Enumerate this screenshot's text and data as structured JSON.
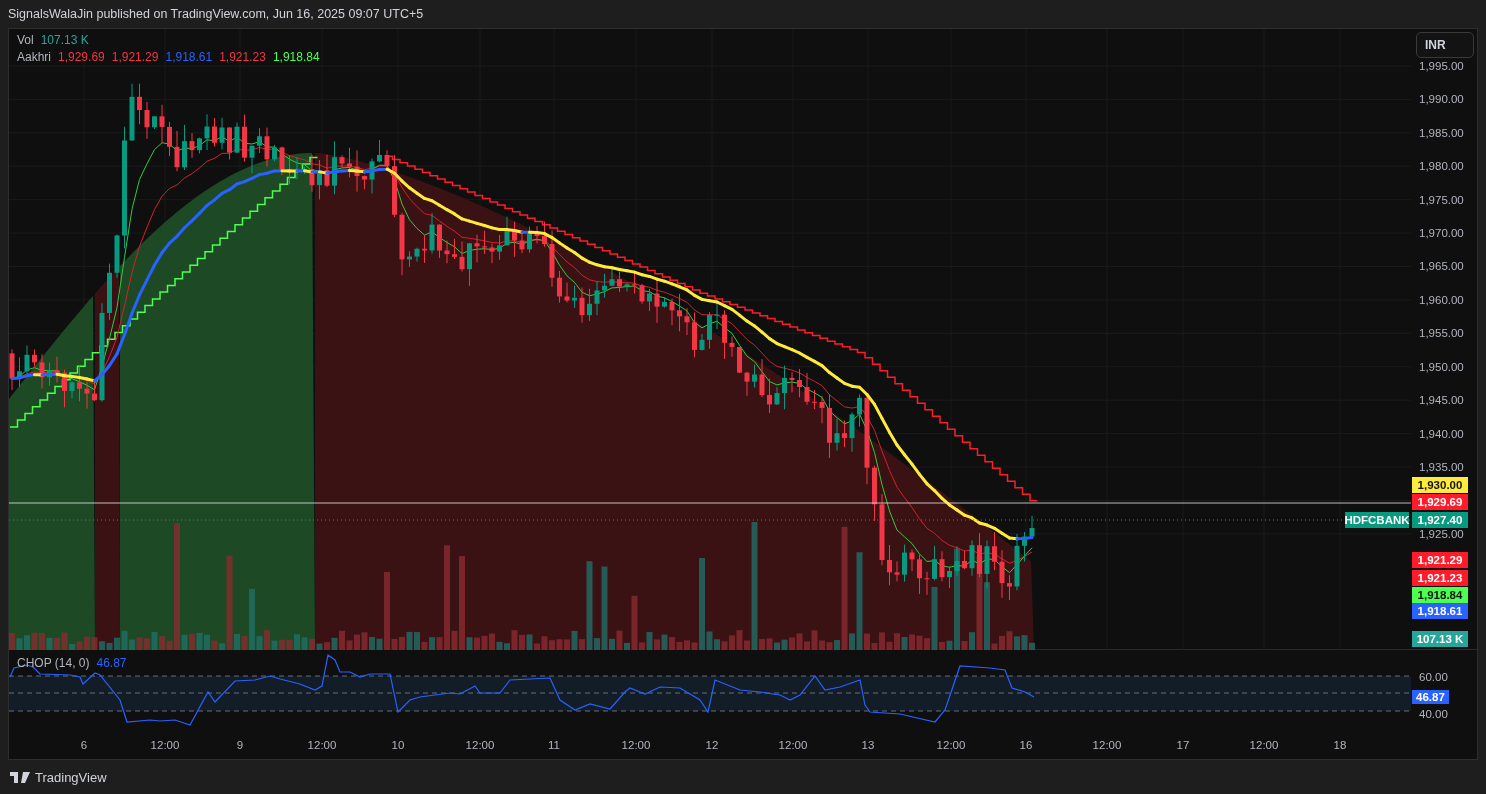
{
  "header": {
    "text": "SignalsWalaJin published on TradingView.com, Jun 16, 2025 09:07 UTC+5"
  },
  "legend": {
    "volume": {
      "label": "Vol",
      "value": "107.13 K"
    },
    "indicator": {
      "name": "Aakhri",
      "values": [
        {
          "text": "1,929.69",
          "color": "#f23645"
        },
        {
          "text": "1,921.29",
          "color": "#f23645"
        },
        {
          "text": "1,918.61",
          "color": "#2962ff"
        },
        {
          "text": "1,921.23",
          "color": "#f23645"
        },
        {
          "text": "1,918.84",
          "color": "#4cff50"
        }
      ]
    }
  },
  "currency_button": "INR",
  "price_axis": [
    "1,995.00",
    "1,990.00",
    "1,985.00",
    "1,980.00",
    "1,975.00",
    "1,970.00",
    "1,965.00",
    "1,960.00",
    "1,955.00",
    "1,950.00",
    "1,945.00",
    "1,940.00",
    "1,935.00"
  ],
  "price_axis_lower": [
    "1,925.00"
  ],
  "price_tags": [
    {
      "text": "1,930.00",
      "color": "#ffeb3b"
    },
    {
      "text": "1,929.69",
      "color": "#ff1c2a"
    },
    {
      "symbol": "HDFCBANK",
      "text": "1,927.40",
      "color": "#089981"
    },
    {
      "text": "1,921.29",
      "color": "#ff1c2a"
    },
    {
      "text": "1,921.23",
      "color": "#ff1c2a"
    },
    {
      "text": "1,918.84",
      "color": "#4cff50"
    },
    {
      "text": "1,918.61",
      "color": "#2962ff"
    },
    {
      "text": "107.13 K",
      "color": "#26a69a"
    }
  ],
  "chop": {
    "label": "CHOP (14, 0)",
    "value": "46.87",
    "axis": [
      "60.00",
      "40.00"
    ],
    "tag": "46.87"
  },
  "time_axis": [
    "6",
    "12:00",
    "9",
    "12:00",
    "10",
    "12:00",
    "11",
    "12:00",
    "12",
    "12:00",
    "13",
    "12:00",
    "16",
    "12:00",
    "17",
    "12:00",
    "18"
  ],
  "footer": {
    "brand": "TradingView"
  }
}
